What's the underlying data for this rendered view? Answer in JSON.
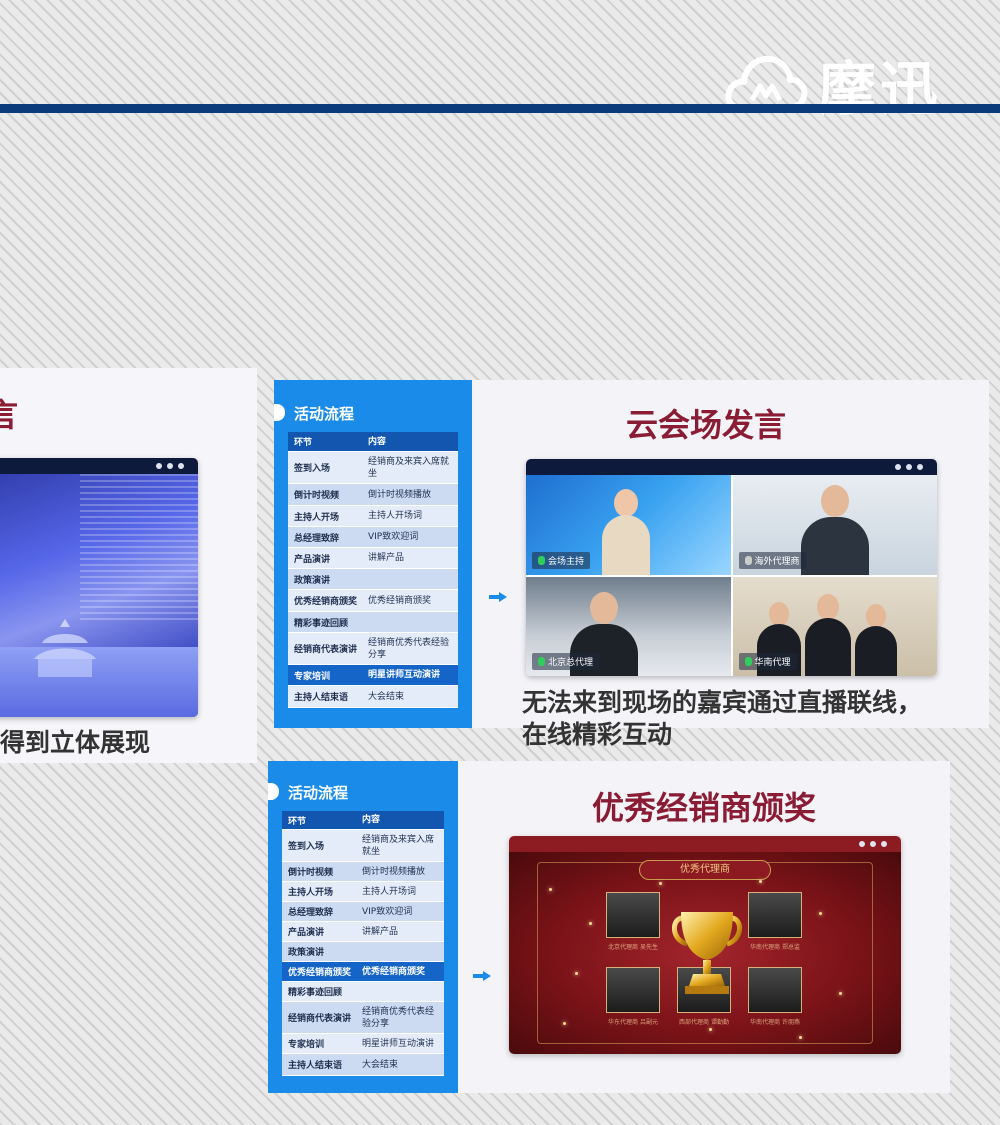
{
  "brand": {
    "name": "摩迅"
  },
  "left_panel": {
    "heading": "言",
    "caption": "得到立体展现"
  },
  "mid_panel": {
    "heading": "云会场发言",
    "caption_line1": "无法来到现场的嘉宾通过直播联线，",
    "caption_line2": "在线精彩互动",
    "video_tiles": [
      {
        "label": "会场主持",
        "mic": "on"
      },
      {
        "label": "海外代理商",
        "mic": "off"
      },
      {
        "label": "北京总代理",
        "mic": "on"
      },
      {
        "label": "华南代理",
        "mic": "on"
      }
    ]
  },
  "bottom_panel": {
    "heading": "优秀经销商颁奖",
    "award_title": "优秀代理商",
    "captions": [
      "北京代理商 吴先生",
      "",
      "华南代理商 郑总监",
      "华东代理商 吕副元",
      "西部代理商 谭勤勤",
      "华南代理商 许朋燕"
    ]
  },
  "flow": {
    "title": "活动流程",
    "header": {
      "c1": "环节",
      "c2": "内容"
    },
    "rows": [
      {
        "c1": "签到入场",
        "c2": "经销商及来宾入席就坐"
      },
      {
        "c1": "倒计时视频",
        "c2": "倒计时视频播放"
      },
      {
        "c1": "主持人开场",
        "c2": "主持人开场词"
      },
      {
        "c1": "总经理致辞",
        "c2": "VIP致欢迎词"
      },
      {
        "c1": "产品演讲",
        "c2": "讲解产品"
      },
      {
        "c1": "政策演讲",
        "c2": ""
      },
      {
        "c1": "优秀经销商颁奖",
        "c2": "优秀经销商颁奖"
      },
      {
        "c1": "精彩事迹回顾",
        "c2": ""
      },
      {
        "c1": "经销商代表演讲",
        "c2": "经销商优秀代表经验分享"
      },
      {
        "c1": "专家培训",
        "c2": "明星讲师互动演讲"
      },
      {
        "c1": "主持人结束语",
        "c2": "大会结束"
      }
    ]
  },
  "colors": {
    "heading": "#8a1c34",
    "flow_bg": "#1a8be8",
    "top_bar": "#0c3b7c",
    "award_bg": "#7a1318"
  },
  "icons": [
    "cloud-logo-icon",
    "arrow-right-icon",
    "microphone-icon",
    "microphone-muted-icon",
    "trophy-icon",
    "window-dots-icon"
  ]
}
